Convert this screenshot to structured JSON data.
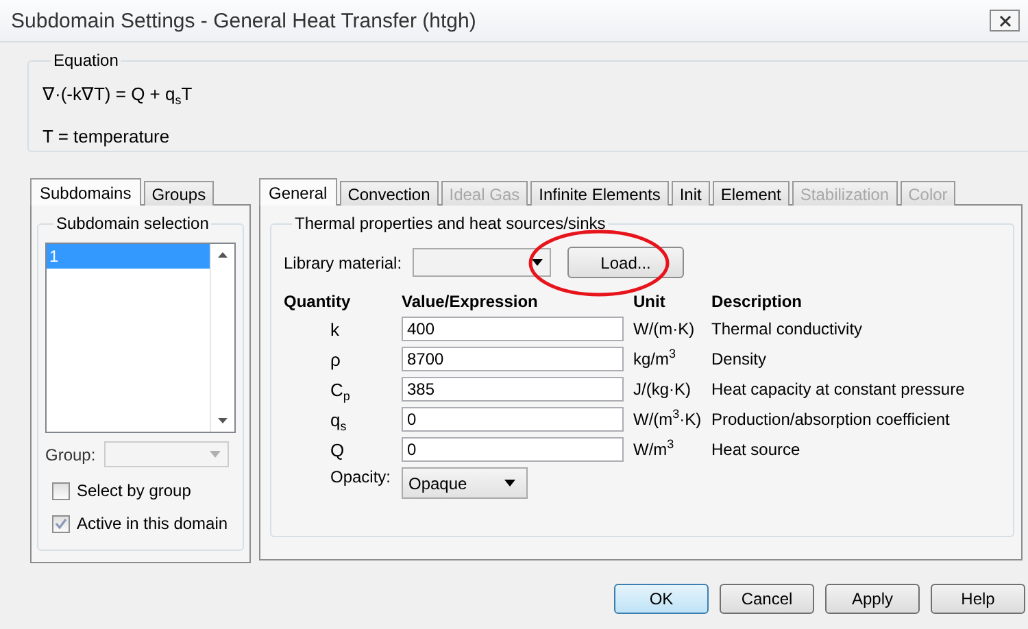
{
  "window": {
    "title": "Subdomain Settings - General Heat Transfer (htgh)"
  },
  "equation": {
    "label": "Equation",
    "formula": "∇·(-k∇T) = Q + q$_{s}$T",
    "legend": "T = temperature"
  },
  "left_tabs": [
    {
      "label": "Subdomains",
      "selected": true
    },
    {
      "label": "Groups",
      "selected": false
    }
  ],
  "subdomain_selection": {
    "label": "Subdomain selection",
    "items": [
      {
        "label": "1",
        "selected": true
      }
    ],
    "group_label": "Group:",
    "group_disabled": true,
    "checkboxes": [
      {
        "label": "Select by group",
        "checked": false
      },
      {
        "label": "Active in this domain",
        "checked": true
      }
    ]
  },
  "tabs": [
    {
      "label": "General",
      "selected": true,
      "disabled": false
    },
    {
      "label": "Convection",
      "selected": false,
      "disabled": false
    },
    {
      "label": "Ideal Gas",
      "selected": false,
      "disabled": true
    },
    {
      "label": "Infinite Elements",
      "selected": false,
      "disabled": false
    },
    {
      "label": "Init",
      "selected": false,
      "disabled": false
    },
    {
      "label": "Element",
      "selected": false,
      "disabled": false
    },
    {
      "label": "Stabilization",
      "selected": false,
      "disabled": true
    },
    {
      "label": "Color",
      "selected": false,
      "disabled": true
    }
  ],
  "properties": {
    "label": "Thermal properties and heat sources/sinks",
    "library_label": "Library material:",
    "load_button": "Load...",
    "columns": [
      "Quantity",
      "Value/Expression",
      "Unit",
      "Description"
    ],
    "rows": [
      {
        "quantity": "k",
        "value": "400",
        "unit": "W/(m·K)",
        "description": "Thermal conductivity"
      },
      {
        "quantity": "ρ",
        "value": "8700",
        "unit": "kg/m$^{3}$",
        "description": "Density"
      },
      {
        "quantity": "C$_{p}$",
        "value": "385",
        "unit": "J/(kg·K)",
        "description": "Heat capacity at constant pressure"
      },
      {
        "quantity": "q$_{s}$",
        "value": "0",
        "unit": "W/(m$^{3}$·K)",
        "description": "Production/absorption coefficient"
      },
      {
        "quantity": "Q",
        "value": "0",
        "unit": "W/m$^{3}$",
        "description": "Heat source"
      }
    ],
    "opacity": {
      "label": "Opacity:",
      "value": "Opaque"
    }
  },
  "buttons": [
    {
      "label": "OK",
      "default": true
    },
    {
      "label": "Cancel",
      "default": false
    },
    {
      "label": "Apply",
      "default": false
    },
    {
      "label": "Help",
      "default": false
    }
  ],
  "annotations": [
    {
      "kind": "ellipse"
    }
  ]
}
